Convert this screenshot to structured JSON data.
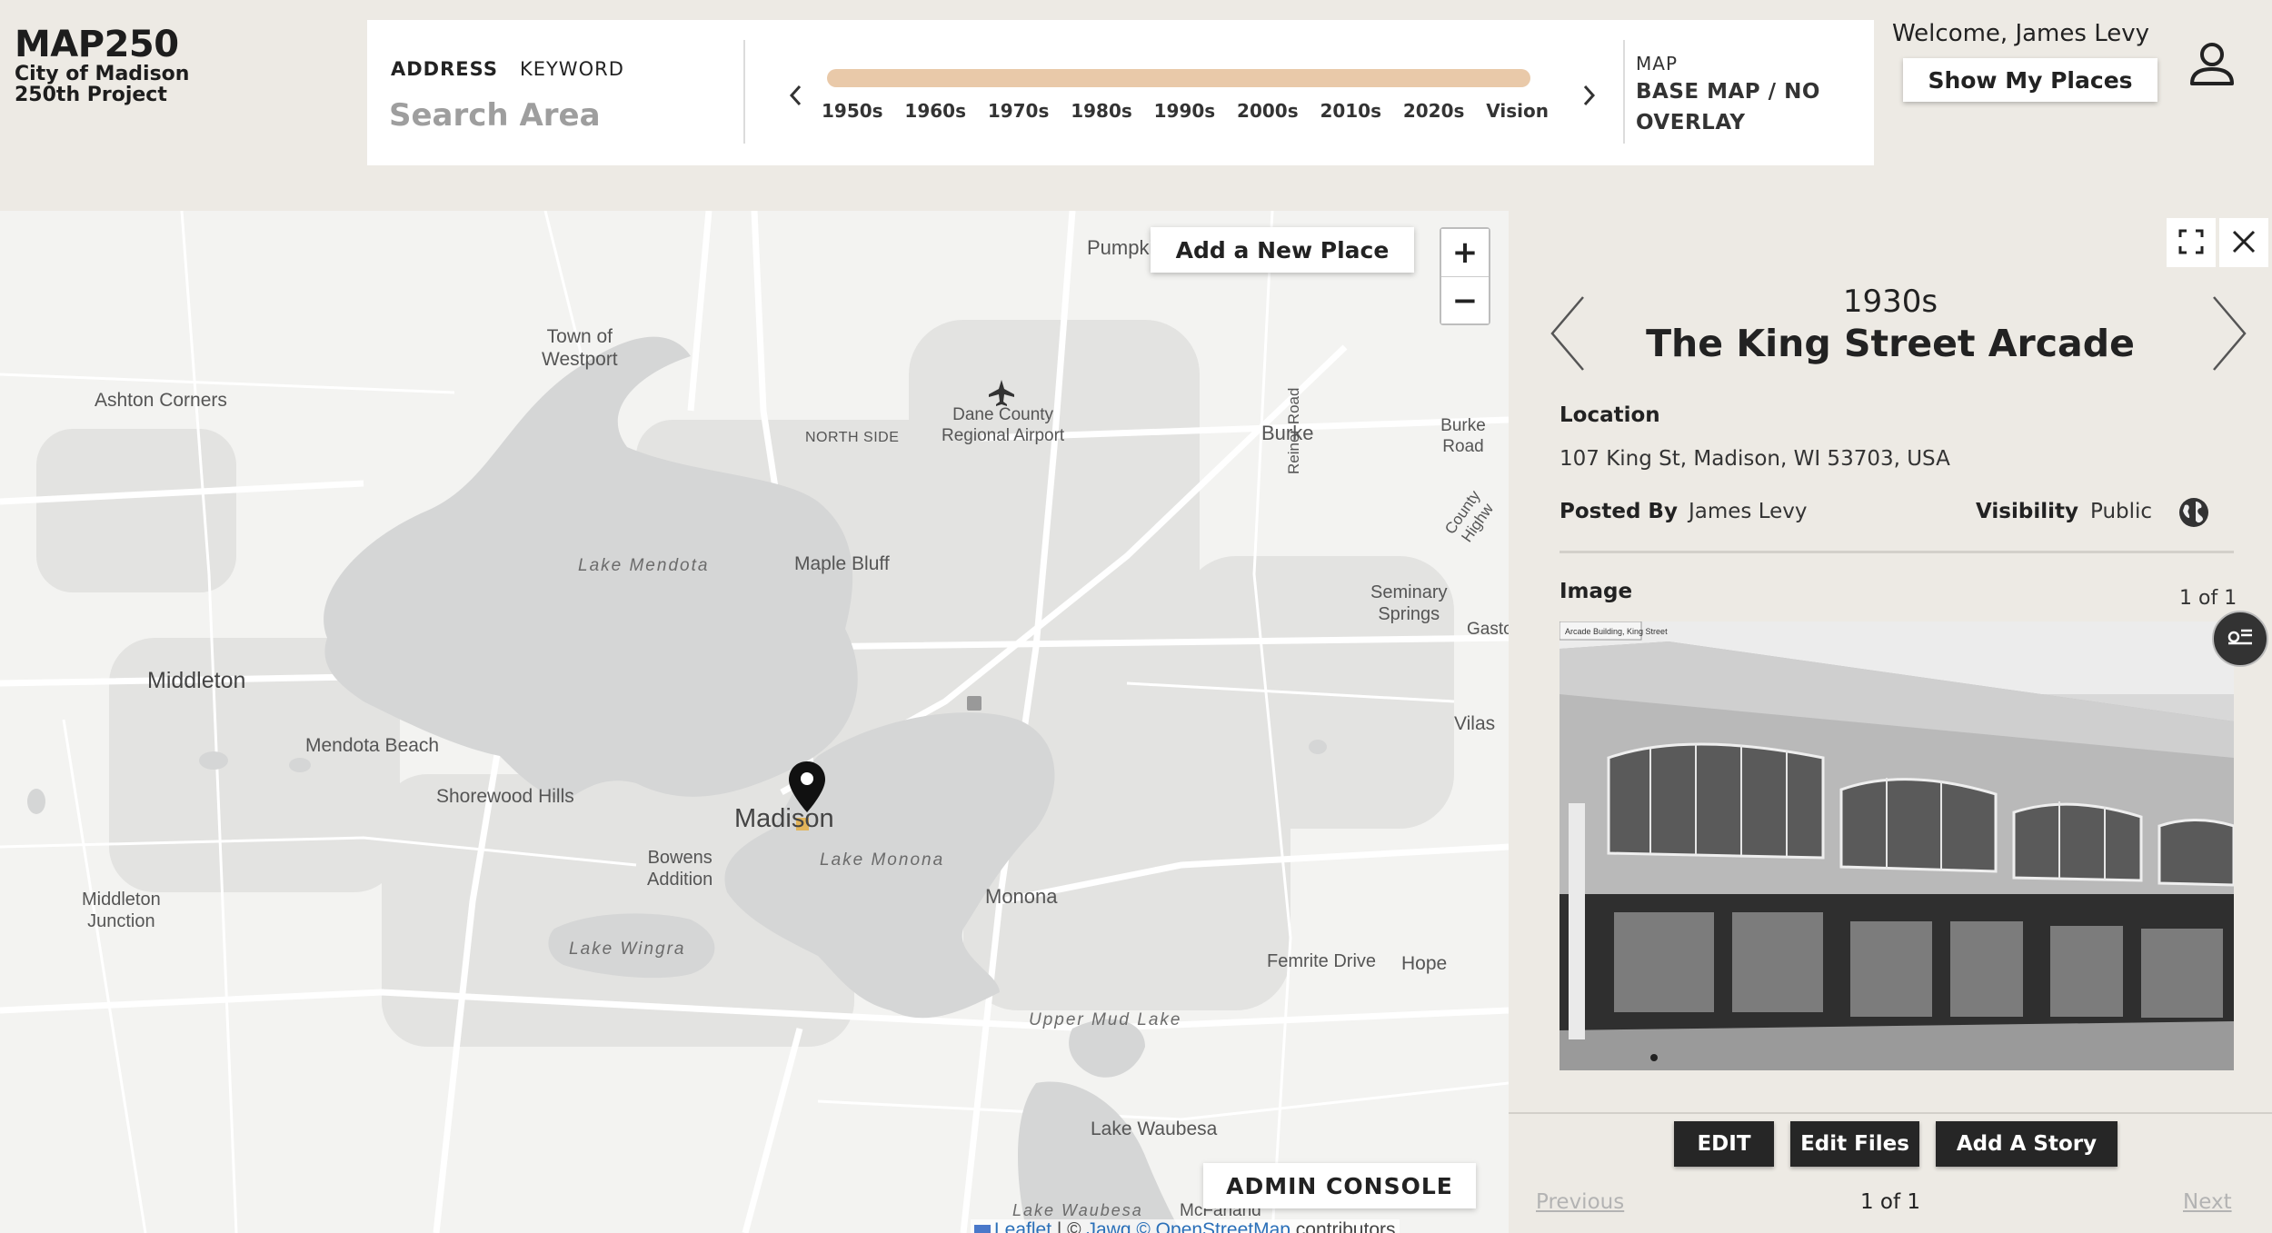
{
  "logo": {
    "title": "MAP250",
    "line1": "City of Madison",
    "line2": "250th Project"
  },
  "search": {
    "tabs": [
      "ADDRESS",
      "KEYWORD"
    ],
    "placeholder": "Search Area"
  },
  "timeline": {
    "years": [
      "1950s",
      "1960s",
      "1970s",
      "1980s",
      "1990s",
      "2000s",
      "2010s",
      "2020s",
      "Vision"
    ],
    "bar_color": "#e9c9a9"
  },
  "map_select": {
    "label": "MAP",
    "value": "BASE MAP / NO OVERLAY"
  },
  "user": {
    "welcome": "Welcome, James Levy",
    "show_places": "Show My Places",
    "icon": "user-icon"
  },
  "map": {
    "add_place": "Add a New Place",
    "zoom_in": "+",
    "zoom_out": "−",
    "admin_console": "ADMIN CONSOLE",
    "attribution": {
      "leaflet": "Leaflet",
      "sep": " | © ",
      "jawg": "Jawg",
      "osm": "© OpenStreetMap",
      "tail": " contributors"
    },
    "labels": {
      "pumpki": "Pumpki",
      "town_of_westport": "Town of\nWestport",
      "ashton_corners": "Ashton Corners",
      "dane_county_airport": "Dane County\nRegional Airport",
      "north_side": "NORTH SIDE",
      "burke": "Burke",
      "burke_road": "Burke Road",
      "reiner_road": "Reiner Road",
      "county_highway": "County Highw",
      "maple_bluff": "Maple Bluff",
      "seminary_springs": "Seminary\nSprings",
      "gasto": "Gasto",
      "middleton": "Middleton",
      "vilas": "Vilas",
      "mendota_beach": "Mendota Beach",
      "shorewood_hills": "Shorewood Hills",
      "madison": "Madison",
      "bowens_addition": "Bowens\nAddition",
      "monona": "Monona",
      "middleton_junction": "Middleton\nJunction",
      "femrite_drive": "Femrite Drive",
      "hope": "Hope",
      "mcfarland": "McFarland",
      "lake_waubesa_town": "Lake Waubesa"
    },
    "lakes": {
      "mendota": "Lake Mendota",
      "monona": "Lake Monona",
      "wingra": "Lake Wingra",
      "upper_mud": "Upper Mud Lake",
      "waubesa": "Lake Waubesa"
    }
  },
  "detail": {
    "era": "1930s",
    "title": "The King Street Arcade",
    "location_label": "Location",
    "location": "107 King St, Madison, WI 53703, USA",
    "posted_by_label": "Posted By",
    "posted_by": "James Levy",
    "visibility_label": "Visibility",
    "visibility": "Public",
    "image_label": "Image",
    "image_counter": "1 of 1",
    "photo_caption": "Arcade Building, King Street",
    "buttons": {
      "edit": "EDIT",
      "edit_files": "Edit Files",
      "add_story": "Add A Story"
    },
    "pager": {
      "previous": "Previous",
      "count": "1 of 1",
      "next": "Next"
    }
  }
}
